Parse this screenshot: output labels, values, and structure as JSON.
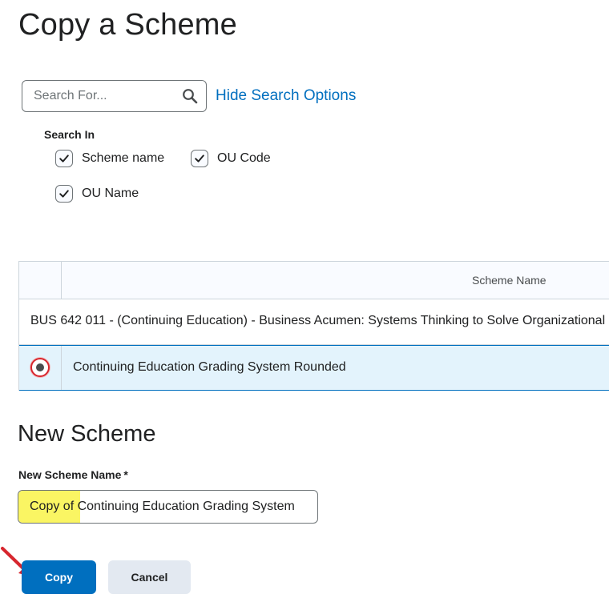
{
  "page": {
    "title": "Copy a Scheme"
  },
  "search": {
    "placeholder": "Search For...",
    "value": "",
    "hide_options_label": "Hide Search Options",
    "search_in_label": "Search In",
    "options": [
      {
        "label": "Scheme name",
        "checked": true
      },
      {
        "label": "OU Code",
        "checked": true
      },
      {
        "label": "OU Name",
        "checked": true
      }
    ]
  },
  "grid": {
    "columns": [
      "",
      "Scheme Name"
    ],
    "rows": [
      {
        "name": "BUS 642 011 - (Continuing Education) - Business Acumen: Systems Thinking to Solve Organizational",
        "selectable": false,
        "selected": false
      },
      {
        "name": "Continuing Education Grading System Rounded",
        "selectable": true,
        "selected": true
      }
    ]
  },
  "new_scheme": {
    "title": "New Scheme",
    "name_label": "New Scheme Name",
    "required_marker": "*",
    "name_value": "Copy of Continuing Education Grading System"
  },
  "buttons": {
    "copy": "Copy",
    "cancel": "Cancel"
  },
  "colors": {
    "link": "#006fbf",
    "primary_button": "#006fbf",
    "selected_row": "#e3f3fc",
    "highlight": "#faf563",
    "annotation_arrow": "#d7262e"
  }
}
